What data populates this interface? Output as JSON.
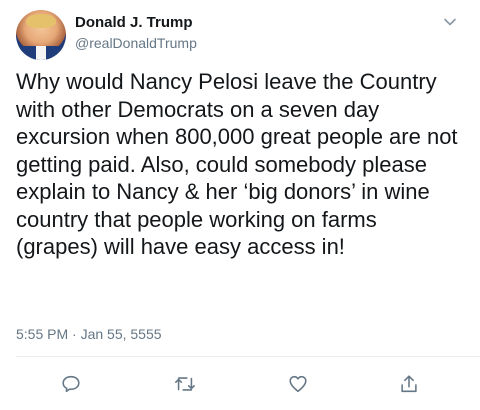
{
  "tweet": {
    "author_name": "Donald J. Trump",
    "author_handle": "@realDonaldTrump",
    "text": "Why would Nancy Pelosi leave the Country with other Democrats on a seven day excursion when 800,000 great people are not getting paid. Also, could somebody please explain to Nancy & her ‘big donors’ in wine country that people working on farms (grapes) will have easy access in!",
    "timestamp": "5:55 PM · Jan 55, 5555"
  },
  "icons": {
    "menu": "chevron-down-icon",
    "reply": "reply-icon",
    "retweet": "retweet-icon",
    "like": "like-icon",
    "share": "share-icon"
  },
  "colors": {
    "text_primary": "#14171a",
    "text_secondary": "#657786",
    "icon": "#657786",
    "divider": "#e6ecf0"
  }
}
